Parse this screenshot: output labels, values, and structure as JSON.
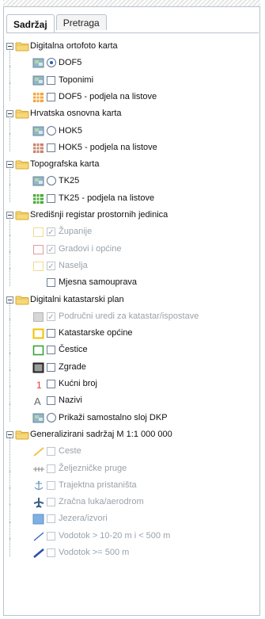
{
  "tabs": [
    {
      "label": "Sadržaj",
      "active": true
    },
    {
      "label": "Pretraga",
      "active": false
    }
  ],
  "tree": [
    {
      "type": "group",
      "label": "Digitalna ortofoto karta"
    },
    {
      "type": "layer",
      "control": "radio",
      "checked": true,
      "label": "DOF5",
      "icon": "map-thumb-icon",
      "dim": false
    },
    {
      "type": "layer",
      "control": "checkbox",
      "checked": false,
      "label": "Toponimi",
      "icon": "map-thumb-icon",
      "dim": false
    },
    {
      "type": "layer",
      "control": "checkbox",
      "checked": false,
      "label": "DOF5 - podjela na listove",
      "icon": "grid-orange-icon",
      "dim": false
    },
    {
      "type": "group",
      "label": "Hrvatska osnovna karta"
    },
    {
      "type": "layer",
      "control": "radio",
      "checked": false,
      "label": "HOK5",
      "icon": "map-thumb-icon",
      "dim": false
    },
    {
      "type": "layer",
      "control": "checkbox",
      "checked": false,
      "label": "HOK5 - podjela na listove",
      "icon": "grid-brown-icon",
      "dim": false
    },
    {
      "type": "group",
      "label": "Topografska karta"
    },
    {
      "type": "layer",
      "control": "radio",
      "checked": false,
      "label": "TK25",
      "icon": "map-thumb-icon",
      "dim": false
    },
    {
      "type": "layer",
      "control": "checkbox",
      "checked": false,
      "label": "TK25 - podjela na listove",
      "icon": "grid-green-icon",
      "dim": false
    },
    {
      "type": "group",
      "label": "Središnji registar prostornih jedinica"
    },
    {
      "type": "layer",
      "control": "checkbox",
      "checked": true,
      "label": "Županije",
      "icon": "box-yellow-icon",
      "dim": true
    },
    {
      "type": "layer",
      "control": "checkbox",
      "checked": true,
      "label": "Gradovi i općine",
      "icon": "box-red-icon",
      "dim": true
    },
    {
      "type": "layer",
      "control": "checkbox",
      "checked": true,
      "label": "Naselja",
      "icon": "box-yellow-icon",
      "dim": true
    },
    {
      "type": "layer",
      "control": "checkbox",
      "checked": false,
      "label": "Mjesna samouprava",
      "icon": "box-empty-icon",
      "dim": false
    },
    {
      "type": "group",
      "label": "Digitalni katastarski plan"
    },
    {
      "type": "layer",
      "control": "checkbox",
      "checked": true,
      "label": "Područni uredi za katastar/ispostave",
      "icon": "box-gray-icon",
      "dim": true
    },
    {
      "type": "layer",
      "control": "checkbox",
      "checked": false,
      "label": "Katastarske općine",
      "icon": "box-yellow-bold-icon",
      "dim": false
    },
    {
      "type": "layer",
      "control": "checkbox",
      "checked": false,
      "label": "Čestice",
      "icon": "box-green-icon",
      "dim": false
    },
    {
      "type": "layer",
      "control": "checkbox",
      "checked": false,
      "label": "Zgrade",
      "icon": "box-dark-icon",
      "dim": false
    },
    {
      "type": "layer",
      "control": "checkbox",
      "checked": false,
      "label": "Kućni broj",
      "icon": "number-one-icon",
      "dim": false
    },
    {
      "type": "layer",
      "control": "checkbox",
      "checked": false,
      "label": "Nazivi",
      "icon": "letter-a-icon",
      "dim": false
    },
    {
      "type": "layer",
      "control": "radio",
      "checked": false,
      "label": "Prikaži samostalno sloj DKP",
      "icon": "map-thumb-icon",
      "dim": false
    },
    {
      "type": "group",
      "label": "Generalizirani sadržaj M 1:1 000 000"
    },
    {
      "type": "layer",
      "control": "checkbox",
      "checked": false,
      "label": "Ceste",
      "icon": "road-icon",
      "dim": true
    },
    {
      "type": "layer",
      "control": "checkbox",
      "checked": false,
      "label": "Željezničke pruge",
      "icon": "railway-icon",
      "dim": true
    },
    {
      "type": "layer",
      "control": "checkbox",
      "checked": false,
      "label": "Trajektna pristaništa",
      "icon": "anchor-icon",
      "dim": true
    },
    {
      "type": "layer",
      "control": "checkbox",
      "checked": false,
      "label": "Zračna luka/aerodrom",
      "icon": "airplane-icon",
      "dim": true
    },
    {
      "type": "layer",
      "control": "checkbox",
      "checked": false,
      "label": "Jezera/izvori",
      "icon": "lake-icon",
      "dim": true
    },
    {
      "type": "layer",
      "control": "checkbox",
      "checked": false,
      "label": "Vodotok > 10-20 m i < 500 m",
      "icon": "river-thin-icon",
      "dim": true
    },
    {
      "type": "layer",
      "control": "checkbox",
      "checked": false,
      "label": "Vodotok >= 500 m",
      "icon": "river-thick-icon",
      "dim": true
    }
  ]
}
